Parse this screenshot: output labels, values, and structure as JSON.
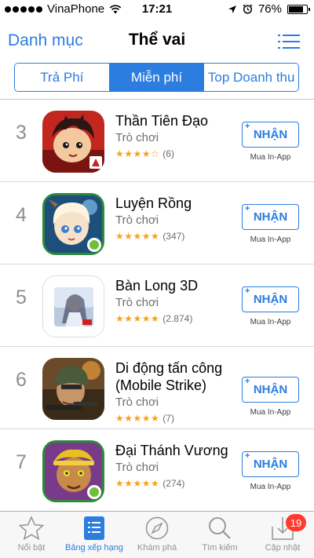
{
  "status_bar": {
    "carrier": "VinaPhone",
    "time": "17:21",
    "battery": "76%"
  },
  "nav": {
    "back_label": "Danh mục",
    "title": "Thể vai"
  },
  "segments": [
    {
      "label": "Trả Phí",
      "active": false
    },
    {
      "label": "Miễn phí",
      "active": true
    },
    {
      "label": "Top Doanh thu",
      "active": false
    }
  ],
  "apps": [
    {
      "rank": "3",
      "name": "Thần Tiên Đạo",
      "category": "Trò chơi",
      "stars": "★★★★☆",
      "rating_count": "(6)",
      "button": "NHẬN",
      "button_plus": "+",
      "iap": "Mua In-App"
    },
    {
      "rank": "4",
      "name": "Luyện Rồng",
      "category": "Trò chơi",
      "stars": "★★★★★",
      "rating_count": "(347)",
      "button": "NHẬN",
      "button_plus": "+",
      "iap": "Mua In-App"
    },
    {
      "rank": "5",
      "name": "Bàn Long 3D",
      "category": "Trò chơi",
      "stars": "★★★★★",
      "rating_count": "(2.874)",
      "button": "NHẬN",
      "button_plus": "+",
      "iap": "Mua In-App"
    },
    {
      "rank": "6",
      "name": "Di động tấn công (Mobile Strike)",
      "category": "Trò chơi",
      "stars": "★★★★★",
      "rating_count": "(7)",
      "button": "NHẬN",
      "button_plus": "+",
      "iap": "Mua In-App"
    },
    {
      "rank": "7",
      "name": "Đại Thánh Vương",
      "category": "Trò chơi",
      "stars": "★★★★★",
      "rating_count": "(274)",
      "button": "NHẬN",
      "button_plus": "+",
      "iap": "Mua In-App"
    }
  ],
  "tabs": [
    {
      "label": "Nổi bật",
      "icon": "star-icon",
      "active": false
    },
    {
      "label": "Bảng xếp hạng",
      "icon": "list-icon",
      "active": true
    },
    {
      "label": "Khám phá",
      "icon": "compass-icon",
      "active": false
    },
    {
      "label": "Tìm kiếm",
      "icon": "search-icon",
      "active": false
    },
    {
      "label": "Cập nhật",
      "icon": "download-icon",
      "active": false,
      "badge": "19"
    }
  ],
  "colors": {
    "accent": "#2b7de0",
    "star": "#f7a21b",
    "badge": "#ff3b30"
  }
}
